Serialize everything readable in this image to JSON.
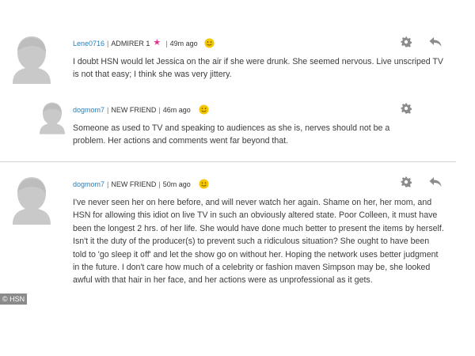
{
  "comments": [
    {
      "username": "Lene0716",
      "role": "ADMIRER 1",
      "time": "49m ago",
      "text": "I doubt HSN would let Jessica on the air if she were drunk. She seemed nervous. Live unscriped TV is not that easy; I think she was very jittery."
    },
    {
      "username": "dogmom7",
      "role": "NEW FRIEND",
      "time": "46m ago",
      "text": "Someone as used to TV and speaking to audiences as she is, nerves should not be a problem.  Her actions and comments went far beyond that."
    },
    {
      "username": "dogmom7",
      "role": "NEW FRIEND",
      "time": "50m ago",
      "text": "I've never seen her on here before, and will never watch her again.  Shame on her, her  mom, and HSN for allowing this idiot on live TV in such an obviously altered state.  Poor Colleen, it must have been the longest 2 hrs. of her life.  She would have done much better to present the items by herself.  Isn't it the duty of the producer(s) to prevent such a ridiculous situation?  She ought to have been told to 'go sleep it off' and let the show go on without her.  Hoping the network uses better judgment in the future.  I don't care how much of a celebrity or fashion maven Simpson may be, she looked awful with that hair in her face, and her actions were as unprofessional as it gets."
    }
  ],
  "separator": "|",
  "watermark": "© HSN",
  "icons": [
    "avatar-icon",
    "star-icon",
    "smiley-icon",
    "gear-icon",
    "reply-icon"
  ],
  "colors": {
    "username": "#2a7fb8",
    "star": "#e2368c",
    "smiley": "#f2c500",
    "avatar": "#c8c8c8"
  }
}
